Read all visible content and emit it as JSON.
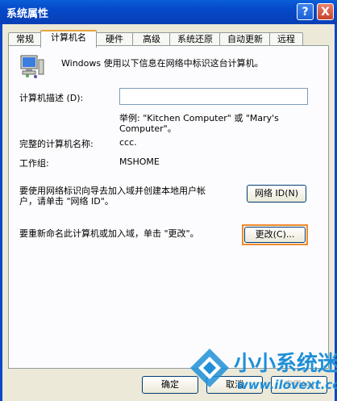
{
  "window": {
    "title": "系统属性",
    "help_button": "?",
    "close_button": "X"
  },
  "tabs": [
    {
      "label": "常规"
    },
    {
      "label": "计算机名"
    },
    {
      "label": "硬件"
    },
    {
      "label": "高级"
    },
    {
      "label": "系统还原"
    },
    {
      "label": "自动更新"
    },
    {
      "label": "远程"
    }
  ],
  "intro_text": "Windows 使用以下信息在网络中标识这台计算机。",
  "description": {
    "label": "计算机描述 (D):",
    "value": "",
    "example_line1": "举例: \"Kitchen Computer\" 或 \"Mary's",
    "example_line2": "Computer\"。"
  },
  "full_name": {
    "label": "完整的计算机名称:",
    "value": "ccc."
  },
  "workgroup": {
    "label": "工作组:",
    "value": "MSHOME"
  },
  "network_id": {
    "text_line1": "要使用网络标识向导去加入域并创建本地用户帐",
    "text_line2": "户，请单击 \"网络 ID\"。",
    "button_label": "网络 ID(N)"
  },
  "rename": {
    "text": "要重新命名此计算机或加入域，单击 \"更改\"。",
    "button_label": "更改(C)..."
  },
  "footer": {
    "ok_label": "确定",
    "cancel_label": "取消",
    "apply_label": "应用(A)"
  },
  "watermark": {
    "brand": "小小系统迷",
    "url": "www.ilovext.com"
  },
  "colors": {
    "titlebar": "#0548c8",
    "dialog_bg": "#ece9d8",
    "panel_bg": "#fcfcfe",
    "highlight": "#f08a2a",
    "active_tab_accent": "#e7a33b"
  }
}
